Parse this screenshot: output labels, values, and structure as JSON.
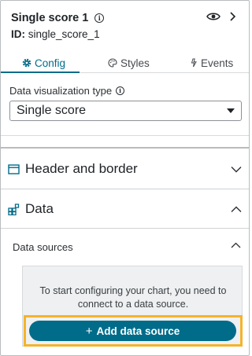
{
  "header": {
    "title": "Single score 1",
    "id_label": "ID:",
    "id_value": "single_score_1"
  },
  "tabs": [
    {
      "label": "Config",
      "icon": "gear-icon",
      "active": true
    },
    {
      "label": "Styles",
      "icon": "palette-icon",
      "active": false
    },
    {
      "label": "Events",
      "icon": "lightning-icon",
      "active": false
    }
  ],
  "config": {
    "data_viz_label": "Data visualization type",
    "data_viz_value": "Single score"
  },
  "sections": {
    "header_border": {
      "label": "Header and border",
      "icon": "window-icon",
      "expanded": false
    },
    "data": {
      "label": "Data",
      "icon": "blocks-icon",
      "expanded": true
    }
  },
  "data_sources": {
    "label": "Data sources",
    "message": "To start configuring your chart, you need to connect to a data source.",
    "button_label": "Add data source",
    "button_plus": "+"
  },
  "colors": {
    "accent": "#006c8a",
    "highlight": "#f5b32b"
  }
}
